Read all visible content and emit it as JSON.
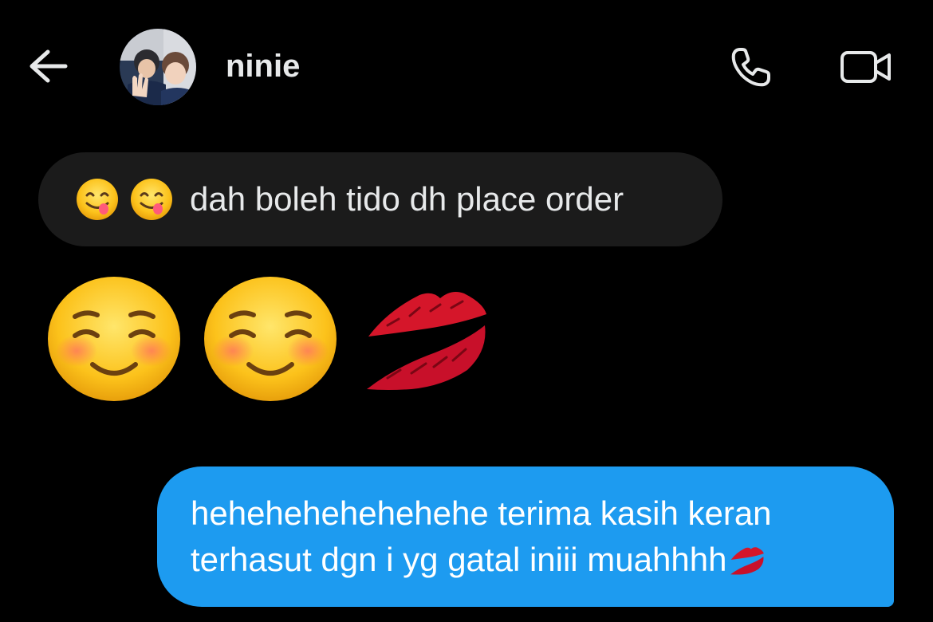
{
  "header": {
    "contact_name": "ninie",
    "icons": {
      "back": "arrow-left-icon",
      "call": "phone-icon",
      "video": "video-camera-icon"
    }
  },
  "messages": [
    {
      "direction": "received",
      "emojis": [
        "face-savoring-food-emoji",
        "face-savoring-food-emoji"
      ],
      "text": "dah boleh tido dh place order"
    },
    {
      "direction": "received",
      "emoji_only": [
        "smiling-face-emoji",
        "smiling-face-emoji",
        "kiss-mark-emoji"
      ]
    },
    {
      "direction": "sent",
      "lines": [
        "hehehehehehehehe terima kasih keran",
        "terhasut dgn i yg gatal iniii muahhhh"
      ],
      "trailing_emoji": "kiss-mark-emoji"
    }
  ],
  "colors": {
    "background": "#000000",
    "received_bubble": "#1b1b1b",
    "sent_bubble": "#1d9bf0",
    "text": "#e7e9ea"
  }
}
